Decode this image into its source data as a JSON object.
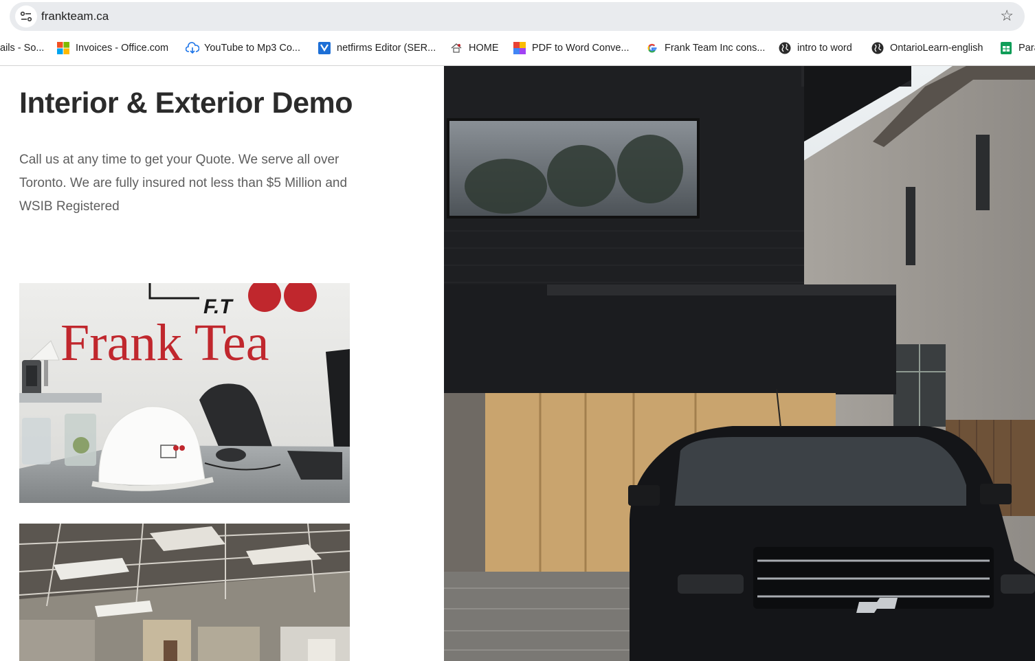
{
  "browser": {
    "url": "frankteam.ca",
    "bookmarks": [
      {
        "label": "ails - So...",
        "icon": "none"
      },
      {
        "label": "Invoices - Office.com",
        "icon": "microsoft-logo-icon"
      },
      {
        "label": "YouTube to Mp3 Co...",
        "icon": "cloud-download-icon"
      },
      {
        "label": "netfirms Editor (SER...",
        "icon": "netfirms-icon"
      },
      {
        "label": "HOME",
        "icon": "house-favicon-icon"
      },
      {
        "label": "PDF to Word Conve...",
        "icon": "pdf-converter-icon"
      },
      {
        "label": "Frank Team Inc cons...",
        "icon": "google-g-icon"
      },
      {
        "label": "intro to word",
        "icon": "globe-icon"
      },
      {
        "label": "OntarioLearn-english",
        "icon": "globe-icon"
      },
      {
        "label": "Para",
        "icon": "sheets-icon"
      }
    ]
  },
  "page": {
    "title": "Interior & Exterior Demo",
    "description": "Call us at any time to get your Quote. We serve all over Toronto. We are fully insured not less than $5 Million and WSIB Registered",
    "photo1": {
      "wall_sign_top": "F.T",
      "wall_sign": "Frank Tea"
    },
    "colors": {
      "brand_red": "#c0272d",
      "title": "#2b2b2b",
      "body_text": "#5e5e5e"
    }
  }
}
